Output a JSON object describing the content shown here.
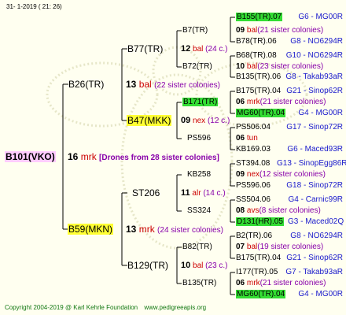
{
  "header": {
    "date": "31-   1-2019  ( 21:  26)"
  },
  "footer": {
    "copyright": "Copyright 2004-2019 @ Karl Kehrle Foundation",
    "site": "www.pedigreeapis.org"
  },
  "colors": {
    "green": "#33dd33",
    "yellow": "#ffff33",
    "pink": "#ffccff",
    "red": "#cc0000",
    "blue": "#1a1acc",
    "purple": "#8800aa"
  },
  "root": {
    "name": "B101(VKO)",
    "num": "16",
    "mrk": "mrk",
    "note": "[Drones from 28 sister colonies]"
  },
  "gen1": [
    {
      "name": "B26(TR)",
      "num": "13",
      "mrk": "bal",
      "note": "(22 sister colonies)"
    },
    {
      "name": "B59(MKN)",
      "num": "13",
      "mrk": "mrk",
      "note": "(24 sister colonies)"
    }
  ],
  "gen2": [
    {
      "name": "B77(TR)",
      "num": "12",
      "mrk": "bal",
      "note": "(24 c.)"
    },
    {
      "name": "B47(MKK)",
      "num": "09",
      "mrk": "nex",
      "note": "(12 c.)"
    },
    {
      "name": "ST206",
      "num": "11",
      "mrk": "alr",
      "note": "(14 c.)"
    },
    {
      "name": "B129(TR)",
      "num": "10",
      "mrk": "bal",
      "note": "(23 c.)"
    }
  ],
  "gen3": [
    {
      "name": "B7(TR)",
      "num": "09",
      "mrk": "bal",
      "note": "(21 sister colonies)"
    },
    {
      "name": "B72(TR)",
      "num": "10",
      "mrk": "bal",
      "note": "(23 sister colonies)"
    },
    {
      "name": "B171(TR)",
      "num": "06",
      "mrk": "mrk",
      "note": "(21 sister colonies)"
    },
    {
      "name": "PS596",
      "num": "06",
      "mrk": "tun",
      "note": ""
    },
    {
      "name": "KB258",
      "num": "09",
      "mrk": "nex",
      "note": "(12 sister colonies)"
    },
    {
      "name": "SS324",
      "num": "08",
      "mrk": "avs",
      "note": "(8 sister colonies)"
    },
    {
      "name": "B82(TR)",
      "num": "07",
      "mrk": "bal",
      "note": "(19 sister colonies)"
    },
    {
      "name": "B135(TR)",
      "num": "06",
      "mrk": "mrk",
      "note": "(21 sister colonies)"
    }
  ],
  "gen4": [
    {
      "name": "B155(TR).07",
      "info": "G6 - MG00R"
    },
    {
      "name": "B78(TR).06",
      "info": "G8 - NO6294R"
    },
    {
      "name": "B68(TR).08",
      "info": "G10 - NO6294R"
    },
    {
      "name": "B135(TR).06",
      "info": "G8 - Takab93aR"
    },
    {
      "name": "B175(TR).04",
      "info": "G21 - Sinop62R"
    },
    {
      "name": "MG60(TR).04",
      "info": "G4 - MG00R"
    },
    {
      "name": "PS506.04",
      "info": "G17 - Sinop72R"
    },
    {
      "name": "KB169.03",
      "info": "G6 - Maced93R"
    },
    {
      "name": "ST394.08",
      "info": "G13 - SinopEgg86R"
    },
    {
      "name": "PS596.06",
      "info": "G18 - Sinop72R"
    },
    {
      "name": "SS504.06",
      "info": "G4 - Carnic99R"
    },
    {
      "name": "D131(HR).05",
      "info": "G3 - Maced02Q"
    },
    {
      "name": "B2(TR).06",
      "info": "G8 - NO6294R"
    },
    {
      "name": "B175(TR).04",
      "info": "G21 - Sinop62R"
    },
    {
      "name": "I177(TR).05",
      "info": "G7 - Takab93aR"
    },
    {
      "name": "MG60(TR).04",
      "info": "G4 - MG00R"
    }
  ]
}
